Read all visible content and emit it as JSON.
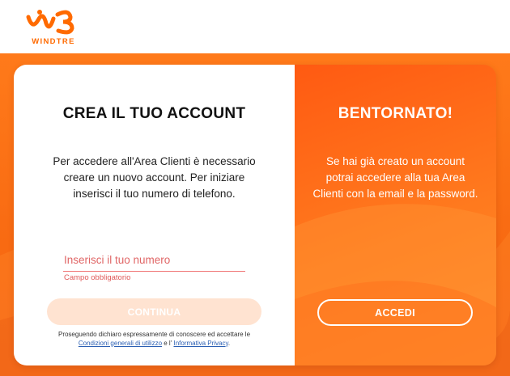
{
  "header": {
    "logo_text": "WINDTRE",
    "logo_icon": "windtre-logo-icon"
  },
  "colors": {
    "brand_orange": "#ff6a00",
    "error_red": "#e05a5a",
    "link_blue": "#2b5fb3"
  },
  "signup": {
    "title": "CREA IL TUO ACCOUNT",
    "description": "Per accedere all'Area Clienti è necessario creare un nuovo account. Per iniziare inserisci il tuo numero di telefono.",
    "phone_placeholder": "Inserisci il tuo numero",
    "phone_value": "",
    "error_text": "Campo obbligatorio",
    "continue_label": "CONTINUA",
    "disclaimer_prefix": "Proseguendo dichiaro espressamente di conoscere ed accettare le",
    "terms_link": "Condizioni generali di utilizzo",
    "disclaimer_middle": "e l'",
    "privacy_link": "Informativa Privacy",
    "disclaimer_suffix": "."
  },
  "login": {
    "title": "BENTORNATO!",
    "description": "Se hai già creato un account potrai accedere alla tua Area Clienti con la email e la password.",
    "accedi_label": "ACCEDI"
  }
}
